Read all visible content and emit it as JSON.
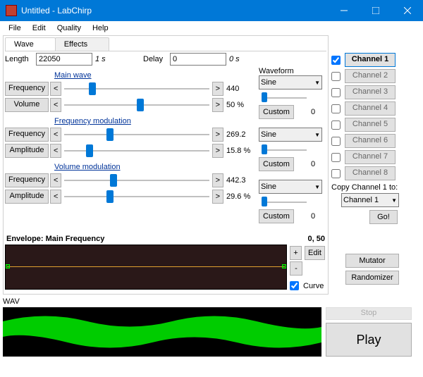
{
  "window": {
    "title": "Untitled - LabChirp"
  },
  "menu": {
    "file": "File",
    "edit": "Edit",
    "quality": "Quality",
    "help": "Help"
  },
  "tabs": {
    "wave": "Wave",
    "effects": "Effects"
  },
  "length": {
    "label": "Length",
    "value": "22050",
    "time": "1 s"
  },
  "delay": {
    "label": "Delay",
    "value": "0",
    "time": "0 s"
  },
  "sections": {
    "main": {
      "title": "Main wave",
      "freq": {
        "label": "Frequency",
        "value": "440",
        "pos": 18
      },
      "vol": {
        "label": "Volume",
        "value": "50 %",
        "pos": 50
      }
    },
    "fmod": {
      "title": "Frequency modulation",
      "freq": {
        "label": "Frequency",
        "value": "269.2",
        "pos": 30
      },
      "amp": {
        "label": "Amplitude",
        "value": "15.8 %",
        "pos": 16
      }
    },
    "vmod": {
      "title": "Volume modulation",
      "freq": {
        "label": "Frequency",
        "value": "442.3",
        "pos": 32
      },
      "amp": {
        "label": "Amplitude",
        "value": "29.6 %",
        "pos": 30
      }
    }
  },
  "waveform": {
    "label": "Waveform",
    "sine": "Sine",
    "custom": "Custom",
    "zero": "0"
  },
  "envelope": {
    "title": "Envelope: Main Frequency",
    "coord": "0, 50",
    "plus": "+",
    "minus": "-",
    "edit": "Edit",
    "curve": "Curve"
  },
  "channels": {
    "list": [
      "Channel 1",
      "Channel 2",
      "Channel 3",
      "Channel 4",
      "Channel 5",
      "Channel 6",
      "Channel 7",
      "Channel 8"
    ],
    "copyLabel": "Copy Channel 1 to:",
    "copyTarget": "Channel 1",
    "go": "Go!"
  },
  "buttons": {
    "mutator": "Mutator",
    "randomizer": "Randomizer",
    "stop": "Stop",
    "play": "Play"
  },
  "wav": "WAV",
  "arrows": {
    "lt": "<",
    "gt": ">"
  }
}
